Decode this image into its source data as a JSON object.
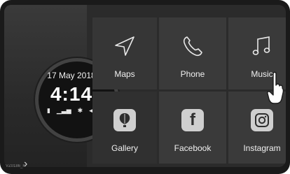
{
  "status": {
    "date": "17 May 2018",
    "time": "4:14",
    "icons": [
      "battery-icon",
      "signal-icon",
      "bluetooth-icon",
      "volume-icon"
    ]
  },
  "apps": [
    {
      "label": "Maps",
      "icon": "navigation-arrow-icon"
    },
    {
      "label": "Phone",
      "icon": "phone-handset-icon"
    },
    {
      "label": "Music",
      "icon": "music-note-icon"
    },
    {
      "label": "Gallery",
      "icon": "gallery-balloon-icon"
    },
    {
      "label": "Facebook",
      "icon": "facebook-icon",
      "glyph": "f"
    },
    {
      "label": "Instagram",
      "icon": "instagram-icon"
    }
  ],
  "colors": {
    "bezel": "#1a1a1a",
    "screen": "#2b2b2b",
    "tile": "#3a3a3a",
    "text": "#f0f0f0"
  }
}
